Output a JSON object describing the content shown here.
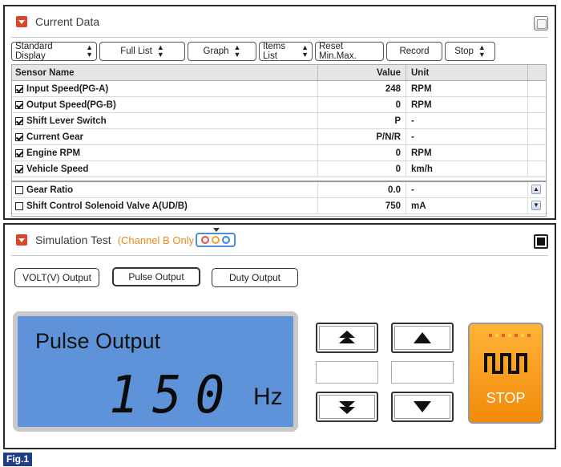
{
  "current_data": {
    "title": "Current Data",
    "toolbar": [
      {
        "label": "Standard Display",
        "dropdown": true
      },
      {
        "label": "Full List",
        "dropdown": true
      },
      {
        "label": "Graph",
        "dropdown": true
      },
      {
        "label": "Items List",
        "dropdown": true
      },
      {
        "label": "Reset Min.Max.",
        "dropdown": false
      },
      {
        "label": "Record",
        "dropdown": false
      },
      {
        "label": "Stop",
        "dropdown": true
      }
    ],
    "columns": {
      "name": "Sensor Name",
      "value": "Value",
      "unit": "Unit"
    },
    "rows": [
      {
        "name": "Input Speed(PG-A)",
        "value": "248",
        "unit": "RPM",
        "checked": true
      },
      {
        "name": "Output Speed(PG-B)",
        "value": "0",
        "unit": "RPM",
        "checked": true
      },
      {
        "name": "Shift Lever Switch",
        "value": "P",
        "unit": "-",
        "checked": true
      },
      {
        "name": "Current Gear",
        "value": "P/N/R",
        "unit": "-",
        "checked": true
      },
      {
        "name": "Engine RPM",
        "value": "0",
        "unit": "RPM",
        "checked": true
      },
      {
        "name": "Vehicle Speed",
        "value": "0",
        "unit": "km/h",
        "checked": true
      }
    ],
    "extra_rows": [
      {
        "name": "Gear Ratio",
        "value": "0.0",
        "unit": "-",
        "checked": false
      },
      {
        "name": "Shift Control Solenoid Valve A(UD/B)",
        "value": "750",
        "unit": "mA",
        "checked": false
      }
    ]
  },
  "simulation": {
    "title": "Simulation Test",
    "channel_note": "(Channel B Only",
    "modes": [
      {
        "label": "VOLT(V) Output",
        "active": false
      },
      {
        "label": "Pulse Output",
        "active": true
      },
      {
        "label": "Duty Output",
        "active": false
      }
    ],
    "display": {
      "title": "Pulse Output",
      "value": "150",
      "unit": "Hz"
    },
    "stop_label": "STOP"
  },
  "figure_label": "Fig.1",
  "colors": {
    "display_bg": "#5e93d9",
    "stop_bg": "#f28a0a",
    "accent_red": "#d9472b",
    "fig_label_bg": "#1f3e86"
  }
}
